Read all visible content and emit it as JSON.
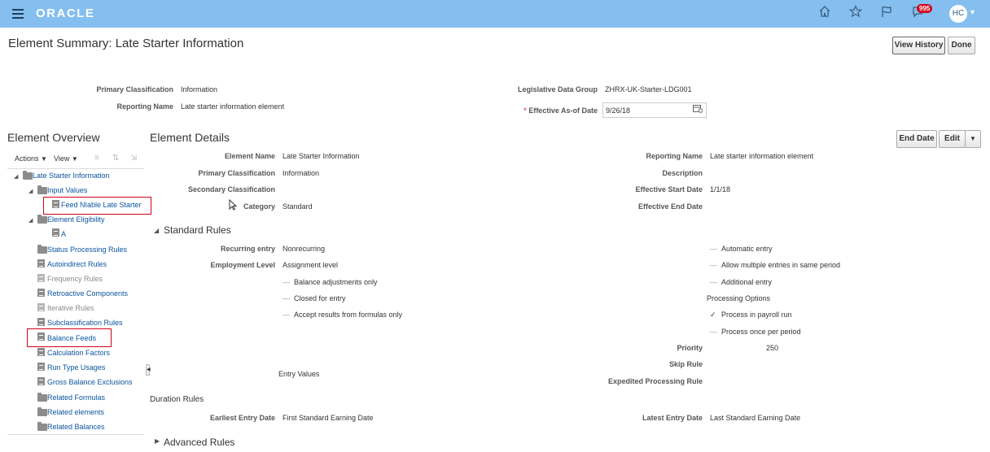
{
  "header": {
    "logo": "ORACLE",
    "notification_count": "995",
    "user_initials": "HC",
    "icons": [
      "home-icon",
      "favorite-star-icon",
      "flag-icon",
      "notifications-bell-icon"
    ]
  },
  "page": {
    "title": "Element Summary: Late Starter Information",
    "view_history_label": "View History",
    "done_label": "Done"
  },
  "summary": {
    "primary_classification_label": "Primary Classification",
    "primary_classification_value": "Information",
    "reporting_name_label": "Reporting Name",
    "reporting_name_value": "Late starter information element",
    "ldg_label": "Legislative Data Group",
    "ldg_value": "ZHRX-UK-Starter-LDG001",
    "eff_date_required": "*",
    "eff_date_label": "Effective As-of Date",
    "eff_date_value": "9/26/18"
  },
  "overview": {
    "title": "Element Overview",
    "actions_label": "Actions",
    "view_label": "View",
    "tree": {
      "root": "Late Starter Information",
      "input_values": "Input Values",
      "feed_niable": "Feed NIable Late Starter",
      "element_eligibility": "Element Eligibility",
      "eligibility_a": "A",
      "status_processing": "Status Processing Rules",
      "autoindirect": "Autoindirect Rules",
      "frequency": "Frequency Rules",
      "retroactive": "Retroactive Components",
      "iterative": "Iterative Rules",
      "subclassification": "Subclassification Rules",
      "balance_feeds": "Balance Feeds",
      "calculation_factors": "Calculation Factors",
      "run_type_usages": "Run Type Usages",
      "gross_balance": "Gross Balance Exclusions",
      "related_formulas": "Related Formulas",
      "related_elements": "Related elements",
      "related_balances": "Related Balances"
    }
  },
  "details": {
    "title": "Element Details",
    "end_date_label": "End Date",
    "edit_label": "Edit",
    "element_name_label": "Element Name",
    "element_name_value": "Late Starter Information",
    "primary_classification_label": "Primary Classification",
    "primary_classification_value": "Information",
    "secondary_classification_label": "Secondary Classification",
    "category_label": "Category",
    "category_value": "Standard",
    "reporting_name_label": "Reporting Name",
    "reporting_name_value": "Late starter information element",
    "description_label": "Description",
    "effective_start_label": "Effective Start Date",
    "effective_start_value": "1/1/18",
    "effective_end_label": "Effective End Date"
  },
  "standard_rules": {
    "title": "Standard Rules",
    "recurring_label": "Recurring entry",
    "recurring_value": "Nonrecurring",
    "employment_level_label": "Employment Level",
    "employment_level_value": "Assignment level",
    "balance_adjustments": "Balance adjustments only",
    "closed_for_entry": "Closed for entry",
    "accept_results": "Accept results from formulas only",
    "entry_values": "Entry Values",
    "automatic_entry": "Automatic entry",
    "allow_multiple": "Allow multiple entries in same period",
    "additional_entry": "Additional entry",
    "processing_options": "Processing Options",
    "process_in_payroll": "Process in payroll run",
    "process_once": "Process once per period",
    "priority_label": "Priority",
    "priority_value": "250",
    "skip_rule_label": "Skip Rule",
    "expedited_label": "Expedited Processing Rule"
  },
  "duration_rules": {
    "title": "Duration Rules",
    "earliest_label": "Earliest Entry Date",
    "earliest_value": "First Standard Earning Date",
    "latest_label": "Latest Entry Date",
    "latest_value": "Last Standard Earning Date"
  },
  "advanced_rules": {
    "title": "Advanced Rules"
  }
}
